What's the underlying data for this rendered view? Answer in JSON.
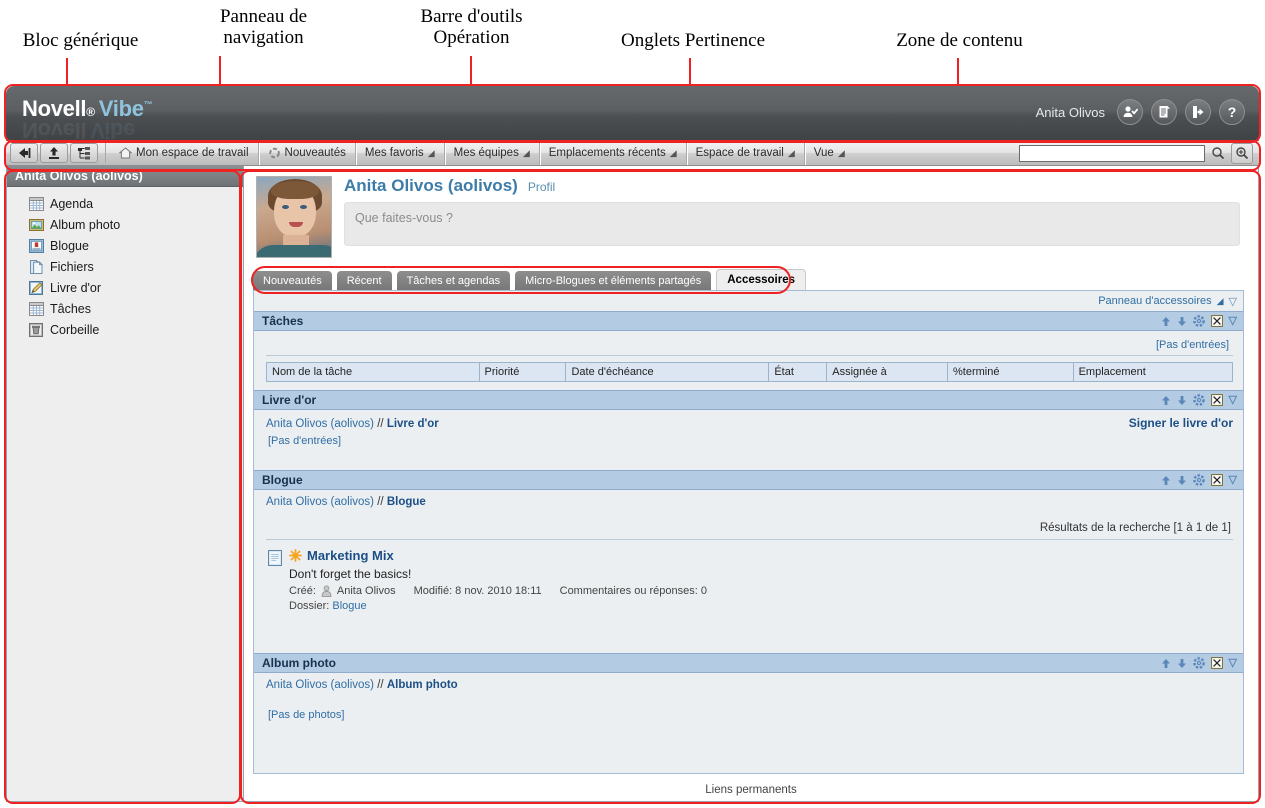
{
  "annotations": [
    {
      "text": "Bloc générique",
      "name": "callout-generic-block"
    },
    {
      "text": "Panneau de\nnavigation",
      "name": "callout-navigation-panel"
    },
    {
      "text": "Barre d'outils\nOpération",
      "name": "callout-operation-toolbar"
    },
    {
      "text": "Onglets Pertinence",
      "name": "callout-relevance-tabs"
    },
    {
      "text": "Zone de contenu",
      "name": "callout-content-area"
    }
  ],
  "accent_color": "#ee2222",
  "masthead": {
    "brand_novell": "Novell",
    "brand_reg": "®",
    "brand_vibe": "Vibe",
    "brand_tm": "™",
    "user_name": "Anita Olivos",
    "buttons": [
      {
        "icon": "user-check-icon",
        "label": "Profil utilisateur"
      },
      {
        "icon": "clipboard-icon",
        "label": "Tâches personnelles"
      },
      {
        "icon": "logout-icon",
        "label": "Déconnexion"
      },
      {
        "icon": "help-icon",
        "label": "?"
      }
    ]
  },
  "toolbar": {
    "icon_buttons": [
      {
        "icon": "back-arrow-icon",
        "label": "Retour"
      },
      {
        "icon": "upload-icon",
        "label": "Ajouter"
      },
      {
        "icon": "tree-icon",
        "label": "Arborescence de l'espace de travail"
      }
    ],
    "items": [
      {
        "label": "Mon espace de travail",
        "icon": "home-icon",
        "has_caret": false
      },
      {
        "label": "Nouveautés",
        "icon": "refresh-icon",
        "has_caret": false
      },
      {
        "label": "Mes favoris",
        "icon": "",
        "has_caret": true
      },
      {
        "label": "Mes équipes",
        "icon": "",
        "has_caret": true
      },
      {
        "label": "Emplacements récents",
        "icon": "",
        "has_caret": true
      },
      {
        "label": "Espace de travail",
        "icon": "",
        "has_caret": true
      },
      {
        "label": "Vue",
        "icon": "",
        "has_caret": true
      }
    ],
    "search_value": "",
    "search_placeholder": "",
    "search_icon": "magnifier-icon",
    "advanced_search_icon": "magnifier-plus-icon"
  },
  "sidebar": {
    "header": "Anita Olivos (aolivos)",
    "items": [
      {
        "label": "Agenda",
        "icon": "calendar-icon"
      },
      {
        "label": "Album photo",
        "icon": "photo-album-icon"
      },
      {
        "label": "Blogue",
        "icon": "blog-icon"
      },
      {
        "label": "Fichiers",
        "icon": "files-icon"
      },
      {
        "label": "Livre d'or",
        "icon": "guestbook-icon"
      },
      {
        "label": "Tâches",
        "icon": "tasks-icon"
      },
      {
        "label": "Corbeille",
        "icon": "trash-icon"
      }
    ]
  },
  "profile": {
    "name": "Anita Olivos (aolivos)",
    "profile_link": "Profil",
    "status_placeholder": "Que faites-vous ?",
    "avatar_name": "avatar"
  },
  "relevance_tabs": [
    {
      "label": "Nouveautés",
      "active": false
    },
    {
      "label": "Récent",
      "active": false
    },
    {
      "label": "Tâches et agendas",
      "active": false
    },
    {
      "label": "Micro-Blogues et éléments partagés",
      "active": false
    },
    {
      "label": "Accessoires",
      "active": true
    }
  ],
  "accessory_panel": {
    "toolbar_link": "Panneau d'accessoires",
    "portlets": {
      "tasks": {
        "title": "Tâches",
        "no_entries": "[Pas d'entrées]",
        "columns": [
          "Nom de la tâche",
          "Priorité",
          "Date d'échéance",
          "État",
          "Assignée à",
          "%terminé",
          "Emplacement"
        ]
      },
      "guestbook": {
        "title": "Livre d'or",
        "crumb_owner": "Anita Olivos (aolivos)",
        "crumb_sep": "//",
        "crumb_current": "Livre d'or",
        "action": "Signer le livre d'or",
        "no_entries": "[Pas d'entrées]"
      },
      "blog": {
        "title": "Blogue",
        "crumb_owner": "Anita Olivos (aolivos)",
        "crumb_sep": "//",
        "crumb_current": "Blogue",
        "results": "Résultats de la recherche [1 à 1 de 1]",
        "entry": {
          "title": "Marketing Mix",
          "description": "Don't forget the basics!",
          "created_label": "Créé:",
          "created_by": "Anita Olivos",
          "modified": "Modifié: 8 nov. 2010 18:11",
          "comments": "Commentaires ou réponses: 0",
          "folder_label": "Dossier:",
          "folder_value": "Blogue",
          "new_icon": "new-item-star-icon",
          "doc_icon": "document-icon"
        }
      },
      "photo_album": {
        "title": "Album photo",
        "crumb_owner": "Anita Olivos (aolivos)",
        "crumb_sep": "//",
        "crumb_current": "Album photo",
        "no_photos": "[Pas de photos]"
      }
    },
    "portlet_actions": [
      {
        "icon": "move-up-icon"
      },
      {
        "icon": "move-down-icon"
      },
      {
        "icon": "configure-gear-icon"
      },
      {
        "icon": "close-x-icon"
      },
      {
        "icon": "collapse-caret-icon"
      }
    ]
  },
  "footer": {
    "permalinks": "Liens permanents"
  }
}
